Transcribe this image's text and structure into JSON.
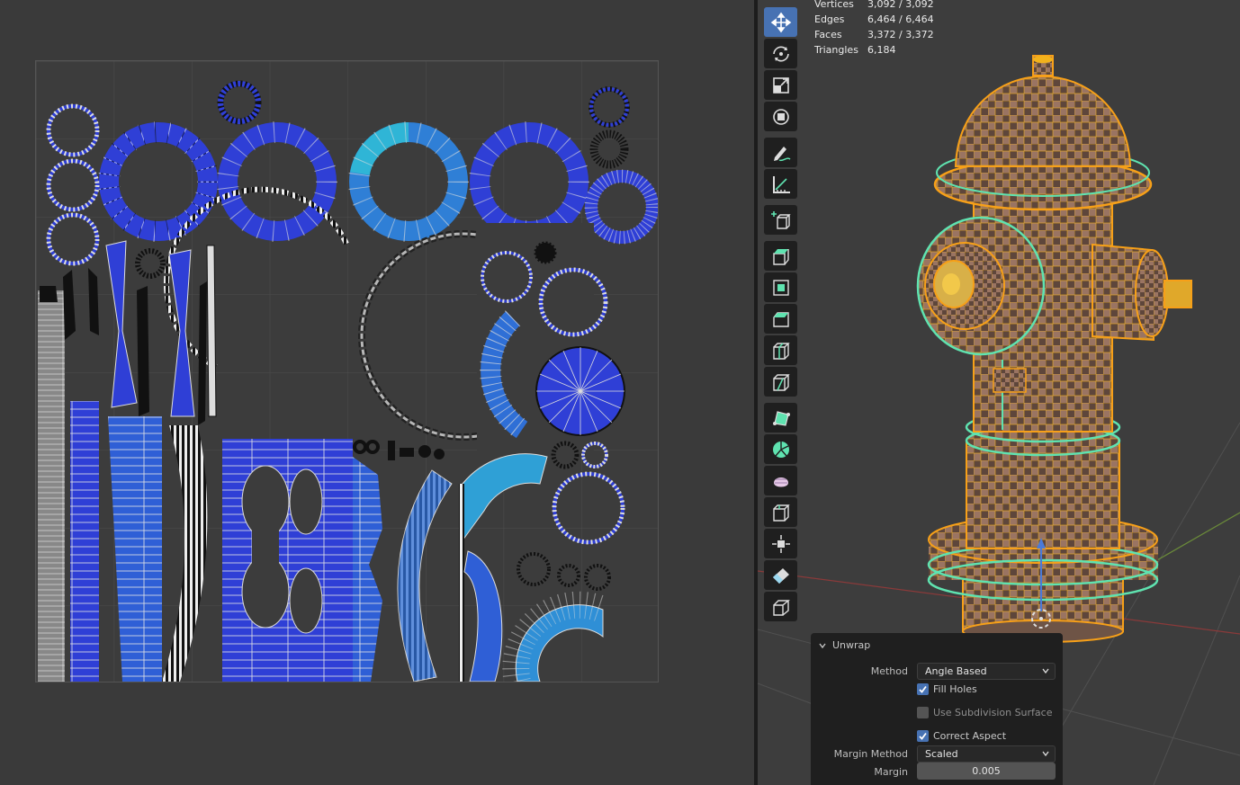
{
  "stats": {
    "vertices_label": "Vertices",
    "vertices_value": "3,092 / 3,092",
    "edges_label": "Edges",
    "edges_value": "6,464 / 6,464",
    "faces_label": "Faces",
    "faces_value": "3,372 / 3,372",
    "triangles_label": "Triangles",
    "triangles_value": "6,184"
  },
  "toolbar": {
    "tools": [
      {
        "icon": "move-icon",
        "active": true
      },
      {
        "icon": "rotate-icon",
        "active": false
      },
      {
        "icon": "scale-icon",
        "active": false
      },
      {
        "icon": "transform-icon",
        "active": false
      },
      {
        "icon": "annotate-icon",
        "active": false
      },
      {
        "icon": "measure-icon",
        "active": false
      },
      {
        "icon": "add-cube-icon",
        "active": false
      },
      {
        "icon": "extrude-icon",
        "active": false
      },
      {
        "icon": "inset-icon",
        "active": false
      },
      {
        "icon": "bevel-icon",
        "active": false
      },
      {
        "icon": "loop-cut-icon",
        "active": false
      },
      {
        "icon": "knife-icon",
        "active": false
      },
      {
        "icon": "poly-build-icon",
        "active": false
      },
      {
        "icon": "spin-icon",
        "active": false
      },
      {
        "icon": "smooth-icon",
        "active": false
      },
      {
        "icon": "edge-slide-icon",
        "active": false
      },
      {
        "icon": "shrink-fatten-icon",
        "active": false
      },
      {
        "icon": "shear-icon",
        "active": false
      },
      {
        "icon": "rip-icon",
        "active": false
      }
    ]
  },
  "unwrap_panel": {
    "title": "Unwrap",
    "method_label": "Method",
    "method_value": "Angle Based",
    "fill_holes_label": "Fill Holes",
    "fill_holes": true,
    "use_subdivision_label": "Use Subdivision Surface",
    "use_subdivision": false,
    "correct_aspect_label": "Correct Aspect",
    "correct_aspect": true,
    "margin_method_label": "Margin Method",
    "margin_method_value": "Scaled",
    "margin_label": "Margin",
    "margin_value": "0.005"
  },
  "colors": {
    "uv_face_blue": "#2f3fd6",
    "uv_face_cyan": "#2fa8d6",
    "mesh_wire": "#f2b21c",
    "mesh_select_edge": "#5fe3b0",
    "active_tool": "#4772b3"
  }
}
